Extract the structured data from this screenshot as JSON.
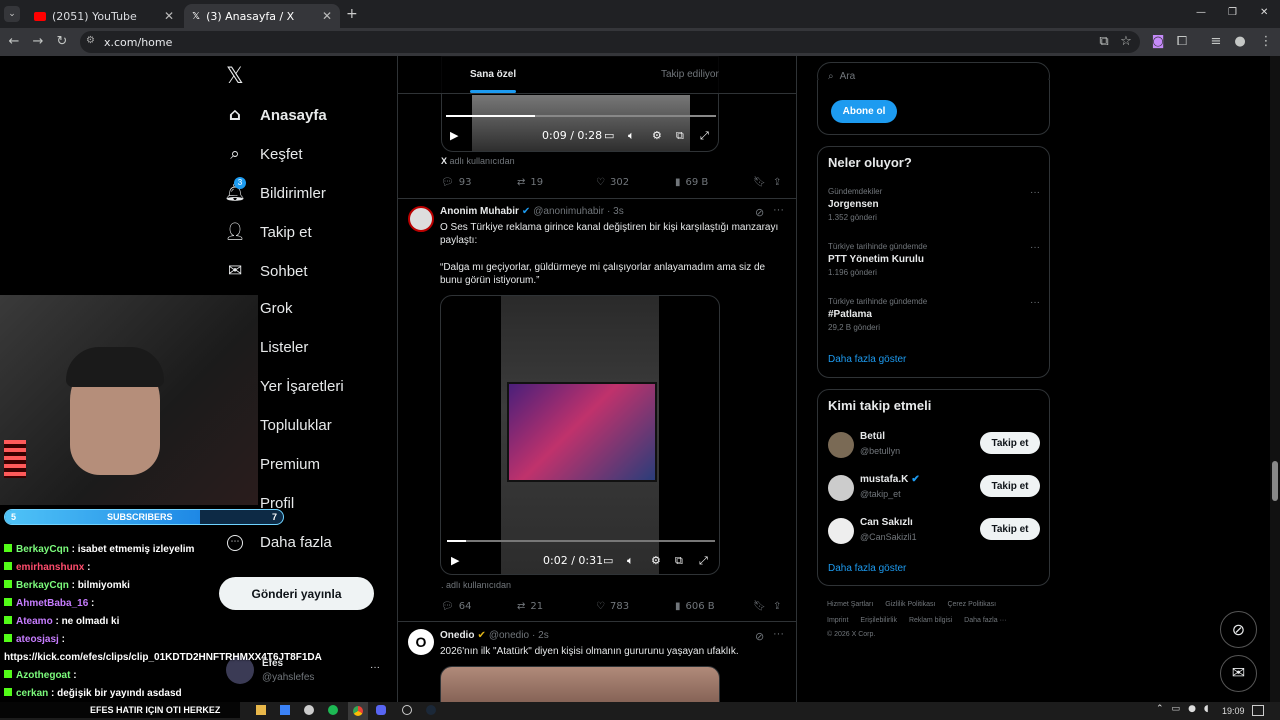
{
  "tabs": [
    {
      "title": "(2051) YouTube",
      "close": "✕"
    },
    {
      "title": "(3) Anasayfa / X",
      "close": "✕"
    }
  ],
  "address": "x.com/home",
  "window_controls": [
    "—",
    "❐",
    "✕"
  ],
  "nav": {
    "logo": "𝕏",
    "items": [
      {
        "label": "Anasayfa",
        "icon": "⌂"
      },
      {
        "label": "Keşfet",
        "icon": "⌕"
      },
      {
        "label": "Bildirimler",
        "icon": "🔔︎"
      },
      {
        "label": "Takip et",
        "icon": "👤︎"
      },
      {
        "label": "Sohbet",
        "icon": "✉"
      },
      {
        "label": "Grok",
        "icon": ""
      },
      {
        "label": "Listeler",
        "icon": ""
      },
      {
        "label": "Yer İşaretleri",
        "icon": ""
      },
      {
        "label": "Topluluklar",
        "icon": ""
      },
      {
        "label": "Premium",
        "icon": ""
      },
      {
        "label": "Profil",
        "icon": ""
      },
      {
        "label": "Daha fazla",
        "icon": "⋯"
      }
    ],
    "notif_badge": "3",
    "post_button": "Gönderi yayınla",
    "account": {
      "name": "Efes",
      "handle": "@yahslefes",
      "more": "···"
    }
  },
  "feed": {
    "tabs": [
      "Sana özel",
      "Takip ediliyor"
    ],
    "tweet1": {
      "video_time": "0:09 / 0:28",
      "source": "X adlı kullanıcıdan",
      "source_prefix": "X",
      "source_suffix": "adlı kullanıcıdan",
      "replies": "93",
      "retweets": "19",
      "likes": "302",
      "views": "69 B"
    },
    "tweet2": {
      "name": "Anonim Muhabir",
      "handle": "@anonimuhabir",
      "time": "· 3s",
      "text1": "O Ses Türkiye reklama girince kanal değiştiren bir kişi karşılaştığı manzarayı paylaştı:",
      "text2": "“Dalga mı geçiyorlar, güldürmeye mi çalışıyorlar anlayamadım ama siz de bunu görün istiyorum.”",
      "video_time": "0:02 / 0:31",
      "source": ". adlı kullanıcıdan",
      "replies": "64",
      "retweets": "21",
      "likes": "783",
      "views": "606 B"
    },
    "tweet3": {
      "name": "Onedio",
      "handle": "@onedio",
      "time": "· 2s",
      "text": "2026'nın ilk \"Atatürk\" diyen kişisi olmanın gururunu yaşayan ufaklık."
    }
  },
  "right": {
    "search_placeholder": "Ara",
    "subscribe_btn": "Abone ol",
    "trends_title": "Neler oluyor?",
    "trends": [
      {
        "context": "Gündemdekiler",
        "name": "Jorgensen",
        "count": "1.352 gönderi"
      },
      {
        "context": "Türkiye tarihinde gündemde",
        "name": "PTT Yönetim Kurulu",
        "count": "1.196 gönderi"
      },
      {
        "context": "Türkiye tarihinde gündemde",
        "name": "#Patlama",
        "count": "29,2 B gönderi"
      }
    ],
    "show_more": "Daha fazla göster",
    "who_title": "Kimi takip etmeli",
    "who": [
      {
        "name": "Betül",
        "handle": "@betullyn",
        "btn": "Takip et"
      },
      {
        "name": "mustafa.K",
        "handle": "@takip_et",
        "btn": "Takip et"
      },
      {
        "name": "Can Sakızlı",
        "handle": "@CanSakizli1",
        "btn": "Takip et"
      }
    ],
    "footer1": [
      "Hizmet Şartları",
      "Gizlilik Politikası",
      "Çerez Politikası"
    ],
    "footer2": [
      "Imprint",
      "Erişilebilirlik",
      "Reklam bilgisi",
      "Daha fazla ···"
    ],
    "copyright": "© 2026 X Corp."
  },
  "overlay": {
    "subs_label": "SUBSCRIBERS",
    "subs_left": "5",
    "subs_right": "7",
    "subs_progress": 0.7,
    "chat": [
      {
        "user": "BerkayCqn",
        "msg": ": isabet etmemiş izleyelim",
        "color": "#7cfc7c"
      },
      {
        "user": "emirhanshunx",
        "msg": ":",
        "color": "#ff4d6d"
      },
      {
        "user": "BerkayCqn",
        "msg": ": bilmiyomki",
        "color": "#7cfc7c"
      },
      {
        "user": "AhmetBaba_16",
        "msg": ":",
        "color": "#c77dff"
      },
      {
        "user": "Ateamo",
        "msg": ": ne olmadı ki",
        "color": "#c77dff"
      },
      {
        "user": "ateosjasj",
        "msg": ":",
        "color": "#c77dff"
      },
      {
        "user": "",
        "msg": "https://kick.com/efes/clips/clip_01KDTD2HNFTRHMXX4T6JT8F1DA",
        "color": "#fff"
      },
      {
        "user": "Azothegoat",
        "msg": ":",
        "color": "#7cfc7c"
      },
      {
        "user": "cerkan",
        "msg": ": değişik bir yayındı asdasd",
        "color": "#7cfc7c"
      }
    ],
    "ticker": "EFES HATIR IÇIN OTI HERKEZ"
  },
  "taskbar": {
    "clock": "19:09"
  },
  "colors": {
    "accent": "#1d9bf0",
    "bg": "#000000",
    "border": "#2f3336",
    "muted": "#71767b"
  }
}
